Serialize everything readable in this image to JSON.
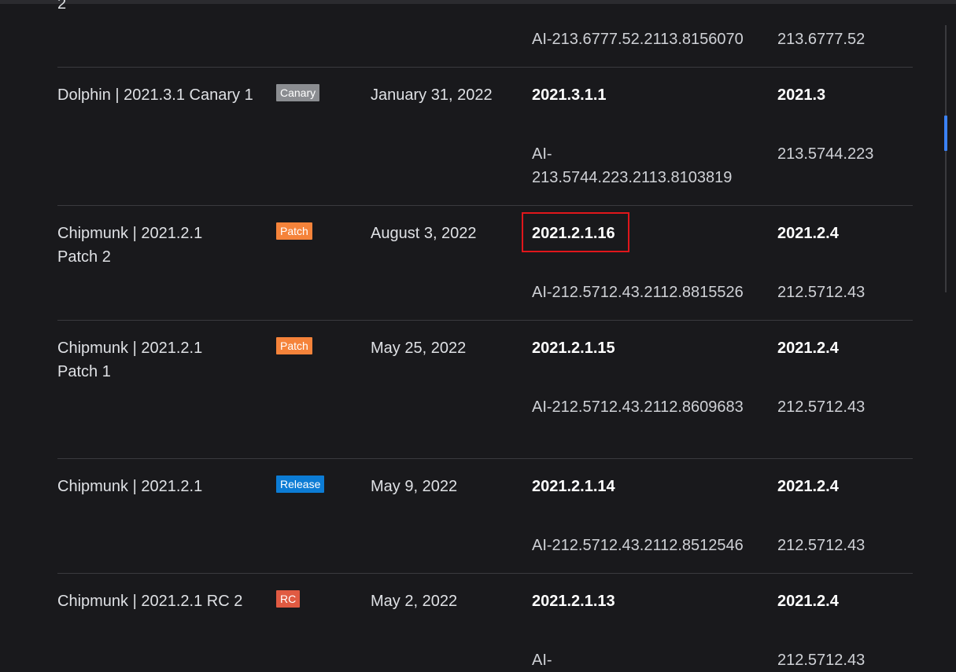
{
  "rows": [
    {
      "name": "2",
      "ai": "AI-213.6777.52.2113.8156070",
      "platform": "213.6777.52"
    },
    {
      "name": "Dolphin | 2021.3.1 Canary 1",
      "badge": "Canary",
      "date": "January 31, 2022",
      "version": "2021.3.1.1",
      "intellij": "2021.3",
      "ai": "AI-213.5744.223.2113.8103819",
      "platform": "213.5744.223"
    },
    {
      "name": "Chipmunk | 2021.2.1 Patch 2",
      "badge": "Patch",
      "date": "August 3, 2022",
      "version": "2021.2.1.16",
      "intellij": "2021.2.4",
      "ai": "AI-212.5712.43.2112.8815526",
      "platform": "212.5712.43"
    },
    {
      "name": "Chipmunk | 2021.2.1 Patch 1",
      "badge": "Patch",
      "date": "May 25, 2022",
      "version": "2021.2.1.15",
      "intellij": "2021.2.4",
      "ai": "AI-212.5712.43.2112.8609683",
      "platform": "212.5712.43"
    },
    {
      "name": "Chipmunk | 2021.2.1",
      "badge": "Release",
      "date": "May 9, 2022",
      "version": "2021.2.1.14",
      "intellij": "2021.2.4",
      "ai": "AI-212.5712.43.2112.8512546",
      "platform": "212.5712.43"
    },
    {
      "name": "Chipmunk | 2021.2.1 RC 2",
      "badge": "RC",
      "date": "May 2, 2022",
      "version": "2021.2.1.13",
      "intellij": "2021.2.4",
      "ai": "AI-",
      "platform": "212.5712.43"
    }
  ],
  "colors": {
    "background": "#19191c",
    "canary": "#8b8d91",
    "patch": "#f5833a",
    "release": "#0c7cd5",
    "rc": "#e05a42",
    "highlight": "#e0161b",
    "scroll_thumb": "#3b82f6"
  }
}
